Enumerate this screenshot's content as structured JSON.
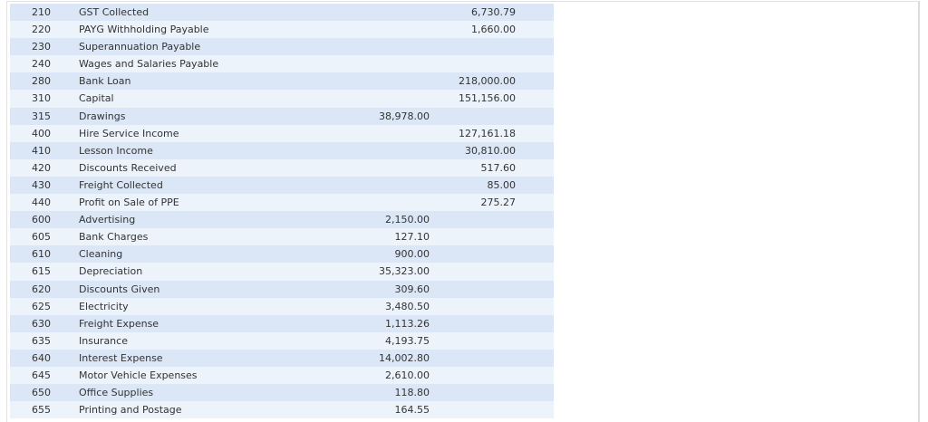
{
  "ledger": {
    "rows": [
      {
        "code": "210",
        "name": "GST Collected",
        "debit": "",
        "credit": "6,730.79"
      },
      {
        "code": "220",
        "name": "PAYG Withholding Payable",
        "debit": "",
        "credit": "1,660.00"
      },
      {
        "code": "230",
        "name": "Superannuation Payable",
        "debit": "",
        "credit": ""
      },
      {
        "code": "240",
        "name": "Wages and Salaries Payable",
        "debit": "",
        "credit": ""
      },
      {
        "code": "280",
        "name": "Bank Loan",
        "debit": "",
        "credit": "218,000.00"
      },
      {
        "code": "310",
        "name": "Capital",
        "debit": "",
        "credit": "151,156.00"
      },
      {
        "code": "315",
        "name": "Drawings",
        "debit": "38,978.00",
        "credit": ""
      },
      {
        "code": "400",
        "name": "Hire Service Income",
        "debit": "",
        "credit": "127,161.18"
      },
      {
        "code": "410",
        "name": "Lesson Income",
        "debit": "",
        "credit": "30,810.00"
      },
      {
        "code": "420",
        "name": "Discounts Received",
        "debit": "",
        "credit": "517.60"
      },
      {
        "code": "430",
        "name": "Freight Collected",
        "debit": "",
        "credit": "85.00"
      },
      {
        "code": "440",
        "name": "Profit on Sale of PPE",
        "debit": "",
        "credit": "275.27"
      },
      {
        "code": "600",
        "name": "Advertising",
        "debit": "2,150.00",
        "credit": ""
      },
      {
        "code": "605",
        "name": "Bank Charges",
        "debit": "127.10",
        "credit": ""
      },
      {
        "code": "610",
        "name": "Cleaning",
        "debit": "900.00",
        "credit": ""
      },
      {
        "code": "615",
        "name": "Depreciation",
        "debit": "35,323.00",
        "credit": ""
      },
      {
        "code": "620",
        "name": "Discounts Given",
        "debit": "309.60",
        "credit": ""
      },
      {
        "code": "625",
        "name": "Electricity",
        "debit": "3,480.50",
        "credit": ""
      },
      {
        "code": "630",
        "name": "Freight Expense",
        "debit": "1,113.26",
        "credit": ""
      },
      {
        "code": "635",
        "name": "Insurance",
        "debit": "4,193.75",
        "credit": ""
      },
      {
        "code": "640",
        "name": "Interest Expense",
        "debit": "14,002.80",
        "credit": ""
      },
      {
        "code": "645",
        "name": "Motor Vehicle Expenses",
        "debit": "2,610.00",
        "credit": ""
      },
      {
        "code": "650",
        "name": "Office Supplies",
        "debit": "118.80",
        "credit": ""
      },
      {
        "code": "655",
        "name": "Printing and Postage",
        "debit": "164.55",
        "credit": ""
      }
    ]
  }
}
